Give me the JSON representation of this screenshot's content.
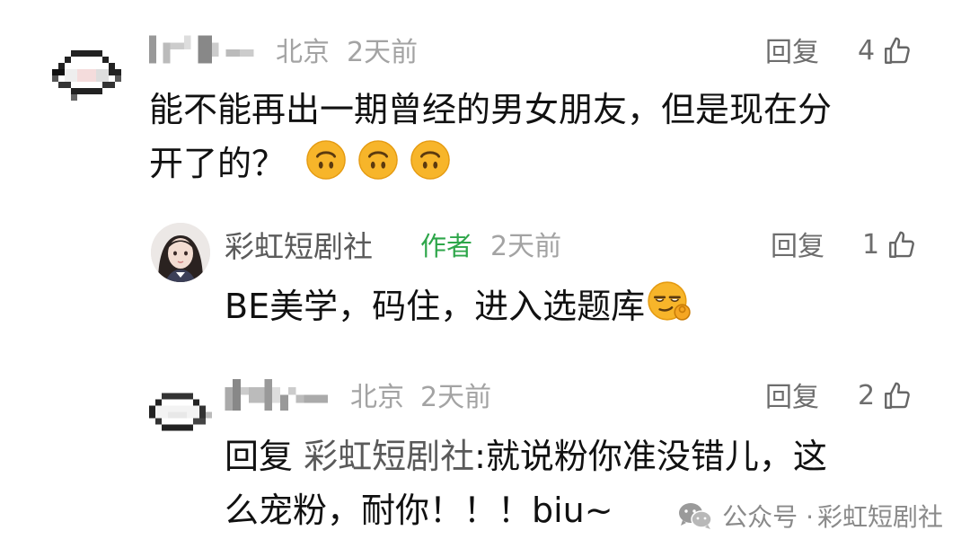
{
  "comments": [
    {
      "location": "北京",
      "time": "2天前",
      "reply_label": "回复",
      "like_count": "4",
      "text_line1": "能不能再出一期曾经的男女朋友，但是现在分",
      "text_line2": "开了的？",
      "emojis": [
        "upside-down-face",
        "upside-down-face",
        "upside-down-face"
      ]
    },
    {
      "author_name": "彩虹短剧社",
      "author_tag": "作者",
      "time": "2天前",
      "reply_label": "回复",
      "like_count": "1",
      "text": "BE美学，码住，进入选题库",
      "emoji": "smirk-ok-face"
    },
    {
      "location": "北京",
      "time": "2天前",
      "reply_label": "回复",
      "like_count": "2",
      "reply_prefix": "回复",
      "reply_target": "彩虹短剧社",
      "text_line1": ":就说粉你准没错儿，这",
      "text_line2": "么宠粉，耐你！！！biu~"
    }
  ],
  "watermark": {
    "prefix": "公众号 · ",
    "account": "彩虹短剧社"
  },
  "colors": {
    "author_tag": "#2ea64a",
    "meta": "#a3a3a3",
    "emoji_face": "#f7b52a"
  }
}
